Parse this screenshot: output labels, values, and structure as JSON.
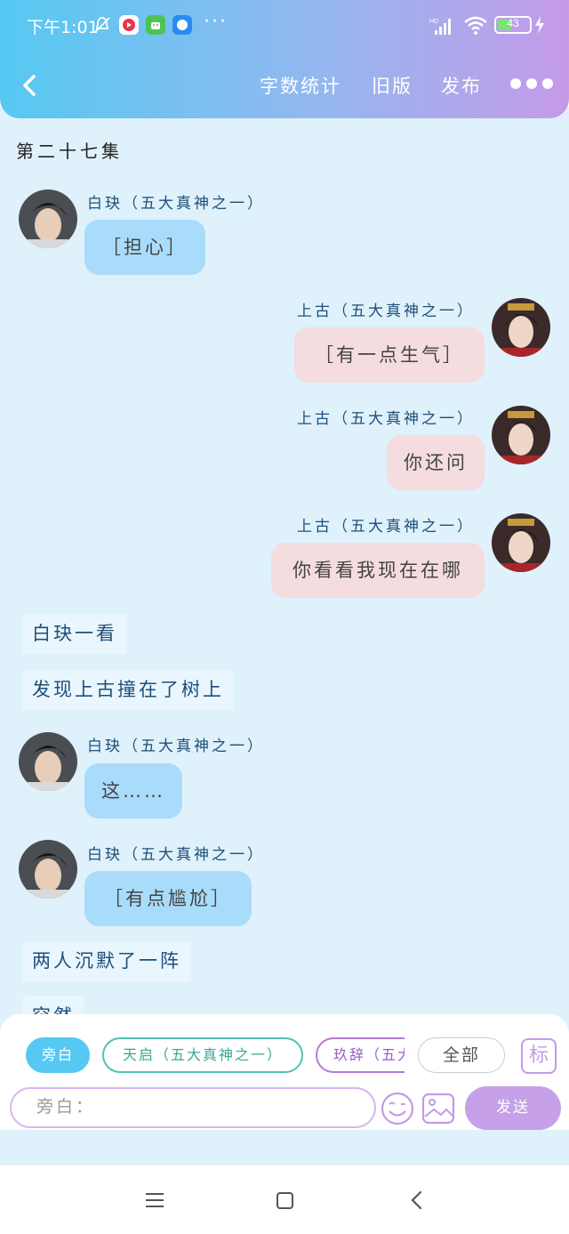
{
  "status_bar": {
    "time": "下午1:01",
    "more": "···",
    "battery": "43",
    "battery_level": 0.43
  },
  "header": {
    "icons": [
      "back-arrow-icon",
      "more-dots-icon"
    ],
    "nav": [
      "字数统计",
      "旧版",
      "发布"
    ]
  },
  "chat": {
    "episode": "第二十七集",
    "messages": [
      {
        "type": "left",
        "speaker": "白玦（五大真神之一）",
        "text": "［担心］"
      },
      {
        "type": "right",
        "speaker": "上古（五大真神之一）",
        "text": "［有一点生气］"
      },
      {
        "type": "right",
        "speaker": "上古（五大真神之一）",
        "text": "你还问"
      },
      {
        "type": "right",
        "speaker": "上古（五大真神之一）",
        "text": "你看看我现在在哪"
      },
      {
        "type": "narration",
        "text": "白玦一看"
      },
      {
        "type": "narration",
        "text": "发现上古撞在了树上"
      },
      {
        "type": "left",
        "speaker": "白玦（五大真神之一）",
        "text": "这……"
      },
      {
        "type": "left",
        "speaker": "白玦（五大真神之一）",
        "text": "［有点尴尬］"
      },
      {
        "type": "narration",
        "text": "两人沉默了一阵"
      },
      {
        "type": "narration",
        "text": "突然"
      }
    ]
  },
  "input_panel": {
    "chips": [
      "旁白",
      "天启（五大真神之一）",
      "玖辞（五大真神之一）",
      "全部"
    ],
    "tag_button": "标",
    "input_placeholder": "旁白：",
    "send": "发送",
    "colors": {
      "accent_blue": "#56c9f2",
      "accent_purple": "#c59ae8"
    }
  },
  "system_nav": {
    "icons": [
      "menu-icon",
      "home-icon",
      "back-icon"
    ]
  }
}
